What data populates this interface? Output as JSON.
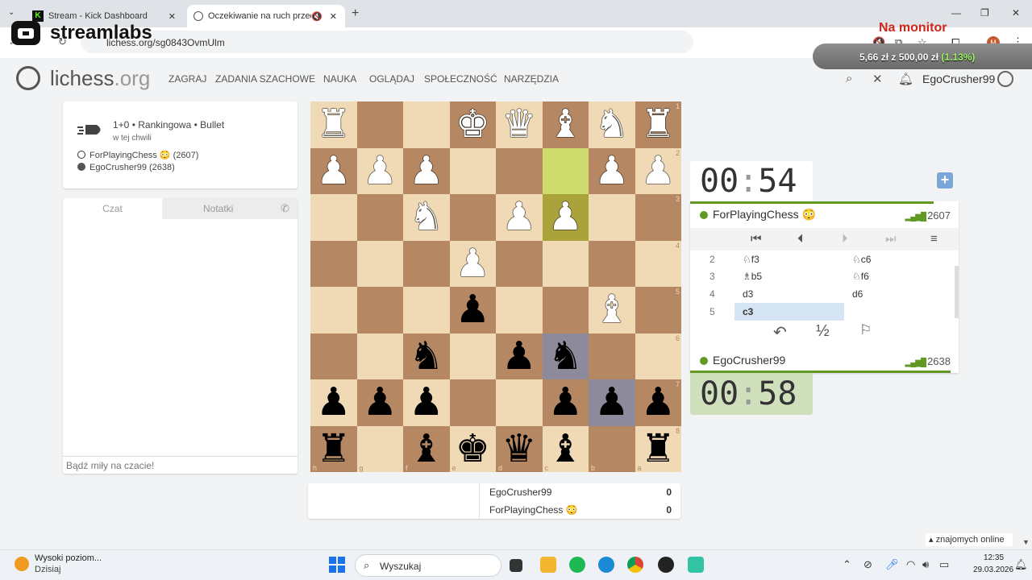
{
  "browser": {
    "tabs": [
      {
        "title": "Stream - Kick Dashboard",
        "favicon": "K"
      },
      {
        "title": "Oczekiwanie na ruch przeciwnika"
      }
    ],
    "url": "lichess.org/sg0843OvmUlm"
  },
  "overlay": {
    "streamlabs": "streamlabs",
    "na_monitor": "Na monitor",
    "donation_amount": "5,66 zł z 500,00 zł",
    "donation_pct": "(1.13%)"
  },
  "lichess": {
    "logo_main": "lichess",
    "logo_suffix": ".org",
    "menu": [
      "ZAGRAJ",
      "ZADANIA SZACHOWE",
      "NAUKA",
      "OGLĄDAJ",
      "SPOŁECZNOŚĆ",
      "NARZĘDZIA"
    ],
    "username": "EgoCrusher99"
  },
  "game": {
    "title": "1+0 • Rankingowa • Bullet",
    "subtitle": "w tej chwili",
    "white": "ForPlayingChess 😳 (2607)",
    "black": "EgoCrusher99 (2638)"
  },
  "chat": {
    "tab_chat": "Czat",
    "tab_notes": "Notatki",
    "placeholder": "Bądź miły na czacie!"
  },
  "board": {
    "ranks": [
      "1",
      "2",
      "3",
      "4",
      "5",
      "6",
      "7",
      "8"
    ],
    "files": [
      "h",
      "g",
      "f",
      "e",
      "d",
      "c",
      "b",
      "a"
    ],
    "rows": [
      [
        "R",
        "",
        "",
        "K",
        "Q",
        "B",
        "N",
        "R"
      ],
      [
        "P",
        "P",
        "P",
        "",
        "",
        "",
        "P",
        "P"
      ],
      [
        "",
        "",
        "N",
        "",
        "P",
        "P",
        "",
        ""
      ],
      [
        "",
        "",
        "",
        "P",
        "",
        "",
        "",
        ""
      ],
      [
        "",
        "",
        "",
        "p",
        "",
        "",
        "B",
        ""
      ],
      [
        "",
        "",
        "n",
        "",
        "p",
        "n",
        "",
        ""
      ],
      [
        "p",
        "p",
        "p",
        "",
        "",
        "p",
        "p",
        "p"
      ],
      [
        "r",
        "",
        "b",
        "k",
        "q",
        "b",
        "",
        "r"
      ]
    ]
  },
  "score": [
    {
      "name": "EgoCrusher99",
      "score": "0"
    },
    {
      "name": "ForPlayingChess 😳",
      "score": "0"
    }
  ],
  "clocks": {
    "top_min": "00",
    "top_sec": "54",
    "bottom_min": "00",
    "bottom_sec": "58"
  },
  "players": {
    "top_name": "ForPlayingChess 😳",
    "top_rating": "2607",
    "bottom_name": "EgoCrusher99",
    "bottom_rating": "2638"
  },
  "moves": [
    {
      "n": "2",
      "w": "♘f3",
      "b": "♘c6"
    },
    {
      "n": "3",
      "w": "♗b5",
      "b": "♘f6"
    },
    {
      "n": "4",
      "w": "d3",
      "b": "d6"
    },
    {
      "n": "5",
      "w": "c3",
      "b": ""
    }
  ],
  "footer": {
    "friends": "znajomych online"
  },
  "taskbar": {
    "weather_title": "Wysoki poziom...",
    "weather_sub": "Dzisiaj",
    "search": "Wyszukaj",
    "time": "12:35",
    "date": "29.03.2026"
  },
  "colors": {
    "lichess_green": "#629924",
    "board_light": "#f0d9b5",
    "board_dark": "#b58863",
    "na_monitor": "#d0251a"
  }
}
